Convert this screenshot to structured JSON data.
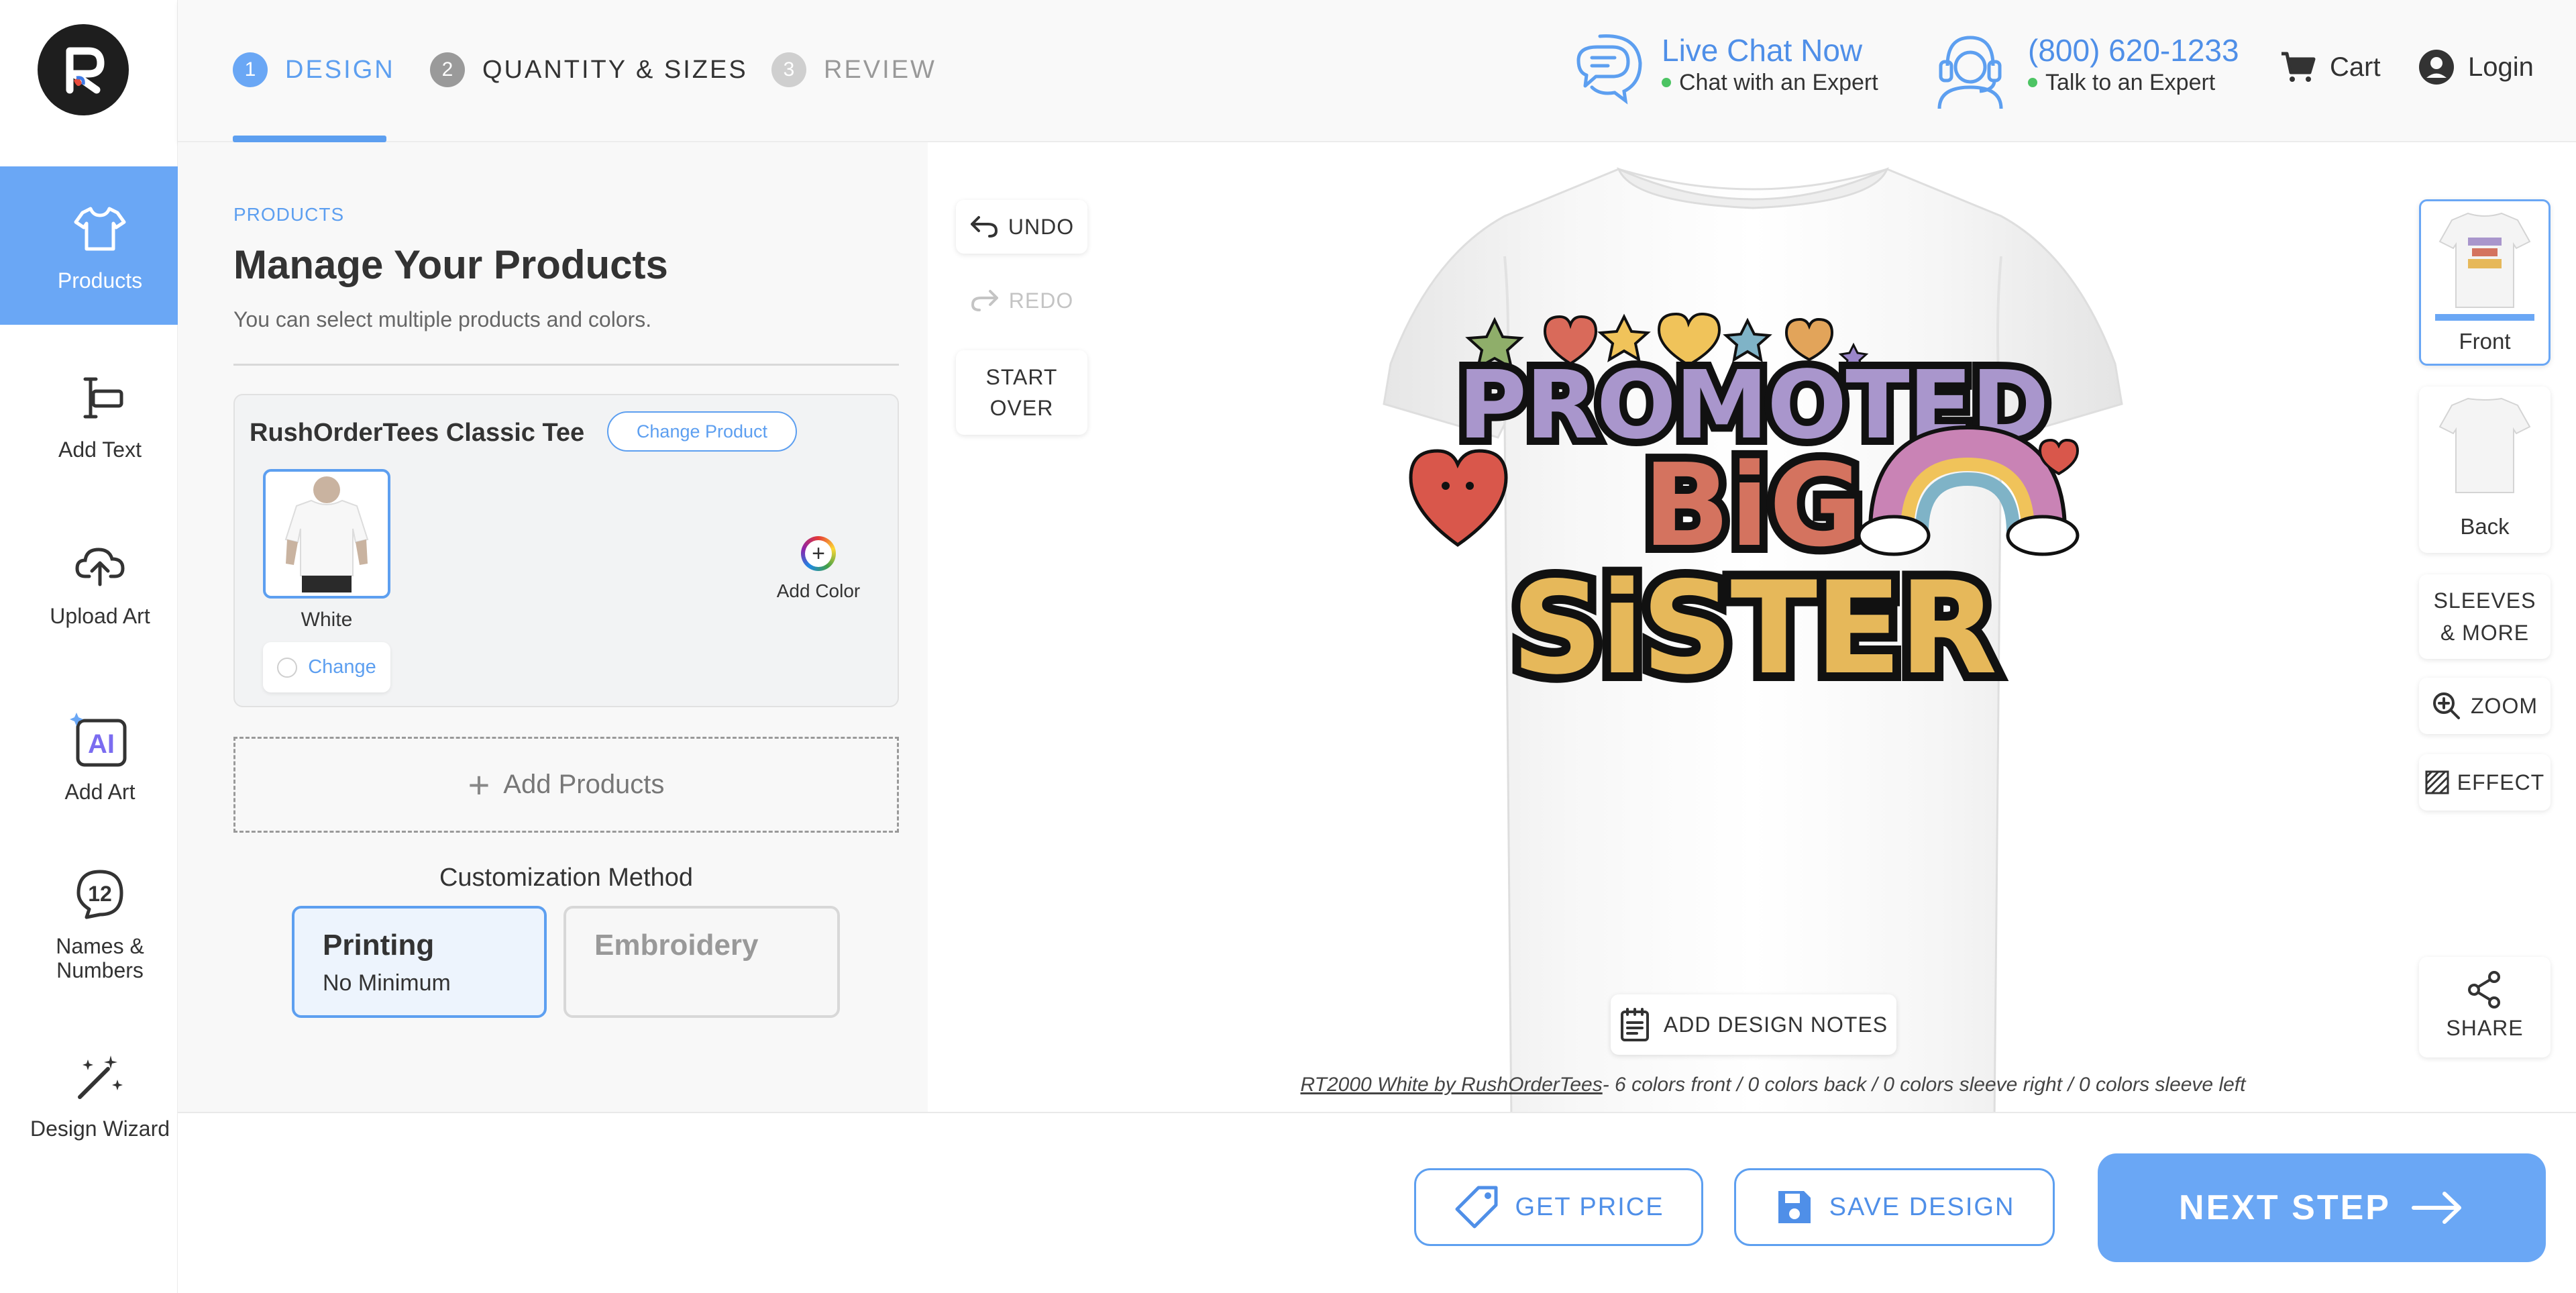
{
  "brand": {
    "logo_letter": "R",
    "accent": "#5d9ff0",
    "active_bg": "#6aa7f5"
  },
  "rail": {
    "items": [
      {
        "label": "Products",
        "icon": "tshirt-icon"
      },
      {
        "label": "Add Text",
        "icon": "text-cursor-icon"
      },
      {
        "label": "Upload Art",
        "icon": "cloud-upload-icon"
      },
      {
        "label": "Add Art",
        "icon": "ai-art-icon"
      },
      {
        "label": "Names &\nNumbers",
        "icon": "number-badge-icon"
      },
      {
        "label": "Design Wizard",
        "icon": "magic-wand-icon"
      }
    ],
    "ai_label": "AI",
    "names_badge": "12"
  },
  "steps": [
    {
      "num": "1",
      "label": "DESIGN",
      "state": "active"
    },
    {
      "num": "2",
      "label": "QUANTITY & SIZES",
      "state": "next"
    },
    {
      "num": "3",
      "label": "REVIEW",
      "state": "future"
    }
  ],
  "header": {
    "chat_title": "Live Chat Now",
    "chat_sub": "Chat with an Expert",
    "phone_title": "(800) 620-1233",
    "phone_sub": "Talk to an Expert",
    "cart": "Cart",
    "login": "Login"
  },
  "panel": {
    "eyebrow": "PRODUCTS",
    "title": "Manage Your Products",
    "subtitle": "You can select multiple products and colors.",
    "product_name": "RushOrderTees Classic Tee",
    "change_product": "Change Product",
    "color_name": "White",
    "change_color": "Change",
    "add_color": "Add Color",
    "add_products": "Add Products",
    "customization_label": "Customization Method",
    "methods": [
      {
        "title": "Printing",
        "sub": "No Minimum",
        "selected": true
      },
      {
        "title": "Embroidery",
        "sub": "",
        "selected": false
      }
    ]
  },
  "canvas": {
    "undo": "UNDO",
    "redo": "REDO",
    "start_over": "START\nOVER",
    "design_words": [
      "PROMOTED",
      "BiG",
      "SiSTER"
    ],
    "design_notes": "ADD DESIGN NOTES",
    "summary_link": "RT2000 White by RushOrderTees",
    "summary_rest": "- 6 colors front  /  0 colors back  /  0 colors sleeve right  /  0 colors sleeve left",
    "views": [
      {
        "label": "Front",
        "active": true
      },
      {
        "label": "Back",
        "active": false
      }
    ],
    "sleeves": "SLEEVES\n& MORE",
    "zoom": "ZOOM",
    "effect": "EFFECT",
    "share": "SHARE"
  },
  "footer": {
    "get_price": "GET PRICE",
    "save_design": "SAVE DESIGN",
    "next_step": "NEXT STEP"
  }
}
